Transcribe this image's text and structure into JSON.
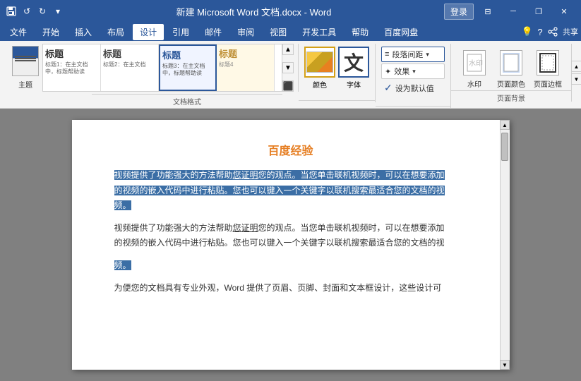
{
  "titlebar": {
    "title": "新建 Microsoft Word 文档.docx  -  Word",
    "word_label": "Word",
    "login_label": "登录",
    "quick_access": [
      "save",
      "undo",
      "redo",
      "customize"
    ],
    "window_buttons": [
      "minimize",
      "restore",
      "close"
    ]
  },
  "menubar": {
    "items": [
      "文件",
      "开始",
      "插入",
      "布局",
      "设计",
      "引用",
      "邮件",
      "审阅",
      "视图",
      "开发工具",
      "帮助",
      "百度网盘"
    ],
    "active_index": 4,
    "icons_right": [
      "lightbulb",
      "help",
      "share"
    ]
  },
  "ribbon": {
    "groups": [
      {
        "label": "文档格式",
        "styles": [
          {
            "name": "主题",
            "type": "main"
          },
          {
            "name": "标题",
            "label_text": "标题",
            "active": false
          },
          {
            "name": "标题1",
            "label_text": "标题",
            "active": false
          },
          {
            "name": "标题2",
            "label_text": "标题",
            "active": true
          },
          {
            "name": "标题3",
            "label_text": "标题",
            "active": false
          }
        ]
      },
      {
        "label": "",
        "color_label": "颜色",
        "font_label": "字体"
      },
      {
        "label": "",
        "para_label": "段落间距",
        "effects_label": "效果",
        "default_label": "设为默认值"
      },
      {
        "label": "页面背景",
        "items": [
          "水印",
          "页面颜色",
          "页面边框"
        ]
      }
    ]
  },
  "document": {
    "title": "百度经验",
    "paragraphs": [
      {
        "selected": true,
        "text_parts": [
          {
            "sel": true,
            "text": "视频提供了功能强大的方法帮助"
          },
          {
            "sel": true,
            "text": "您证明",
            "underline": true
          },
          {
            "sel": true,
            "text": "您的观点。当您单击联机视频时，可以在想要添加"
          },
          {
            "sel": true,
            "text": "的视频的嵌入代码中进行粘贴。您也可以键入一个关键字以联机搜索最适合您的文档的视"
          },
          {
            "sel": true,
            "text": "频。"
          }
        ]
      },
      {
        "selected": false,
        "text_parts": [
          {
            "sel": false,
            "text": "视频提供了功能强大的方法帮助"
          },
          {
            "sel": false,
            "text": "您证明",
            "underline": true
          },
          {
            "sel": false,
            "text": "您的观点。当您单击联机视频时，可以在想要添加"
          },
          {
            "sel": false,
            "text": "的视频的嵌入代码中进行粘贴。您也可以键入一个关键字以联机搜索最适合您的文档的视"
          }
        ]
      },
      {
        "selected": false,
        "partial": true,
        "text_parts": [
          {
            "sel": false,
            "text": "频。"
          }
        ]
      },
      {
        "selected": false,
        "text_parts": [
          {
            "sel": false,
            "text": "为便您的文档具有专业外观，Word 提供了页眉、页脚、封面和文本框设计，这些设计可"
          }
        ]
      }
    ]
  }
}
